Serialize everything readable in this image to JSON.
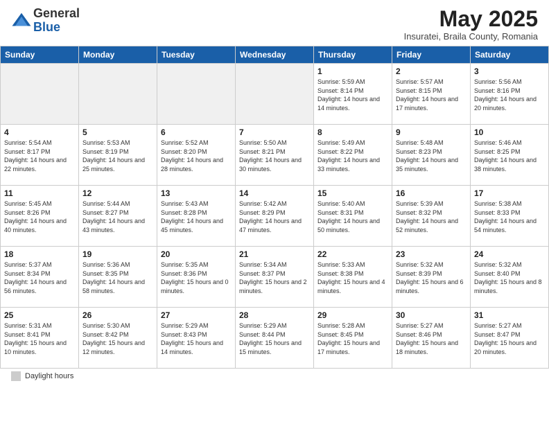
{
  "header": {
    "logo_general": "General",
    "logo_blue": "Blue",
    "month_year": "May 2025",
    "location": "Insuratei, Braila County, Romania"
  },
  "days_of_week": [
    "Sunday",
    "Monday",
    "Tuesday",
    "Wednesday",
    "Thursday",
    "Friday",
    "Saturday"
  ],
  "footer": {
    "label": "Daylight hours"
  },
  "weeks": [
    [
      {
        "day": "",
        "empty": true
      },
      {
        "day": "",
        "empty": true
      },
      {
        "day": "",
        "empty": true
      },
      {
        "day": "",
        "empty": true
      },
      {
        "day": "1",
        "sunrise": "5:59 AM",
        "sunset": "8:14 PM",
        "daylight": "14 hours and 14 minutes."
      },
      {
        "day": "2",
        "sunrise": "5:57 AM",
        "sunset": "8:15 PM",
        "daylight": "14 hours and 17 minutes."
      },
      {
        "day": "3",
        "sunrise": "5:56 AM",
        "sunset": "8:16 PM",
        "daylight": "14 hours and 20 minutes."
      }
    ],
    [
      {
        "day": "4",
        "sunrise": "5:54 AM",
        "sunset": "8:17 PM",
        "daylight": "14 hours and 22 minutes."
      },
      {
        "day": "5",
        "sunrise": "5:53 AM",
        "sunset": "8:19 PM",
        "daylight": "14 hours and 25 minutes."
      },
      {
        "day": "6",
        "sunrise": "5:52 AM",
        "sunset": "8:20 PM",
        "daylight": "14 hours and 28 minutes."
      },
      {
        "day": "7",
        "sunrise": "5:50 AM",
        "sunset": "8:21 PM",
        "daylight": "14 hours and 30 minutes."
      },
      {
        "day": "8",
        "sunrise": "5:49 AM",
        "sunset": "8:22 PM",
        "daylight": "14 hours and 33 minutes."
      },
      {
        "day": "9",
        "sunrise": "5:48 AM",
        "sunset": "8:23 PM",
        "daylight": "14 hours and 35 minutes."
      },
      {
        "day": "10",
        "sunrise": "5:46 AM",
        "sunset": "8:25 PM",
        "daylight": "14 hours and 38 minutes."
      }
    ],
    [
      {
        "day": "11",
        "sunrise": "5:45 AM",
        "sunset": "8:26 PM",
        "daylight": "14 hours and 40 minutes."
      },
      {
        "day": "12",
        "sunrise": "5:44 AM",
        "sunset": "8:27 PM",
        "daylight": "14 hours and 43 minutes."
      },
      {
        "day": "13",
        "sunrise": "5:43 AM",
        "sunset": "8:28 PM",
        "daylight": "14 hours and 45 minutes."
      },
      {
        "day": "14",
        "sunrise": "5:42 AM",
        "sunset": "8:29 PM",
        "daylight": "14 hours and 47 minutes."
      },
      {
        "day": "15",
        "sunrise": "5:40 AM",
        "sunset": "8:31 PM",
        "daylight": "14 hours and 50 minutes."
      },
      {
        "day": "16",
        "sunrise": "5:39 AM",
        "sunset": "8:32 PM",
        "daylight": "14 hours and 52 minutes."
      },
      {
        "day": "17",
        "sunrise": "5:38 AM",
        "sunset": "8:33 PM",
        "daylight": "14 hours and 54 minutes."
      }
    ],
    [
      {
        "day": "18",
        "sunrise": "5:37 AM",
        "sunset": "8:34 PM",
        "daylight": "14 hours and 56 minutes."
      },
      {
        "day": "19",
        "sunrise": "5:36 AM",
        "sunset": "8:35 PM",
        "daylight": "14 hours and 58 minutes."
      },
      {
        "day": "20",
        "sunrise": "5:35 AM",
        "sunset": "8:36 PM",
        "daylight": "15 hours and 0 minutes."
      },
      {
        "day": "21",
        "sunrise": "5:34 AM",
        "sunset": "8:37 PM",
        "daylight": "15 hours and 2 minutes."
      },
      {
        "day": "22",
        "sunrise": "5:33 AM",
        "sunset": "8:38 PM",
        "daylight": "15 hours and 4 minutes."
      },
      {
        "day": "23",
        "sunrise": "5:32 AM",
        "sunset": "8:39 PM",
        "daylight": "15 hours and 6 minutes."
      },
      {
        "day": "24",
        "sunrise": "5:32 AM",
        "sunset": "8:40 PM",
        "daylight": "15 hours and 8 minutes."
      }
    ],
    [
      {
        "day": "25",
        "sunrise": "5:31 AM",
        "sunset": "8:41 PM",
        "daylight": "15 hours and 10 minutes."
      },
      {
        "day": "26",
        "sunrise": "5:30 AM",
        "sunset": "8:42 PM",
        "daylight": "15 hours and 12 minutes."
      },
      {
        "day": "27",
        "sunrise": "5:29 AM",
        "sunset": "8:43 PM",
        "daylight": "15 hours and 14 minutes."
      },
      {
        "day": "28",
        "sunrise": "5:29 AM",
        "sunset": "8:44 PM",
        "daylight": "15 hours and 15 minutes."
      },
      {
        "day": "29",
        "sunrise": "5:28 AM",
        "sunset": "8:45 PM",
        "daylight": "15 hours and 17 minutes."
      },
      {
        "day": "30",
        "sunrise": "5:27 AM",
        "sunset": "8:46 PM",
        "daylight": "15 hours and 18 minutes."
      },
      {
        "day": "31",
        "sunrise": "5:27 AM",
        "sunset": "8:47 PM",
        "daylight": "15 hours and 20 minutes."
      }
    ]
  ]
}
